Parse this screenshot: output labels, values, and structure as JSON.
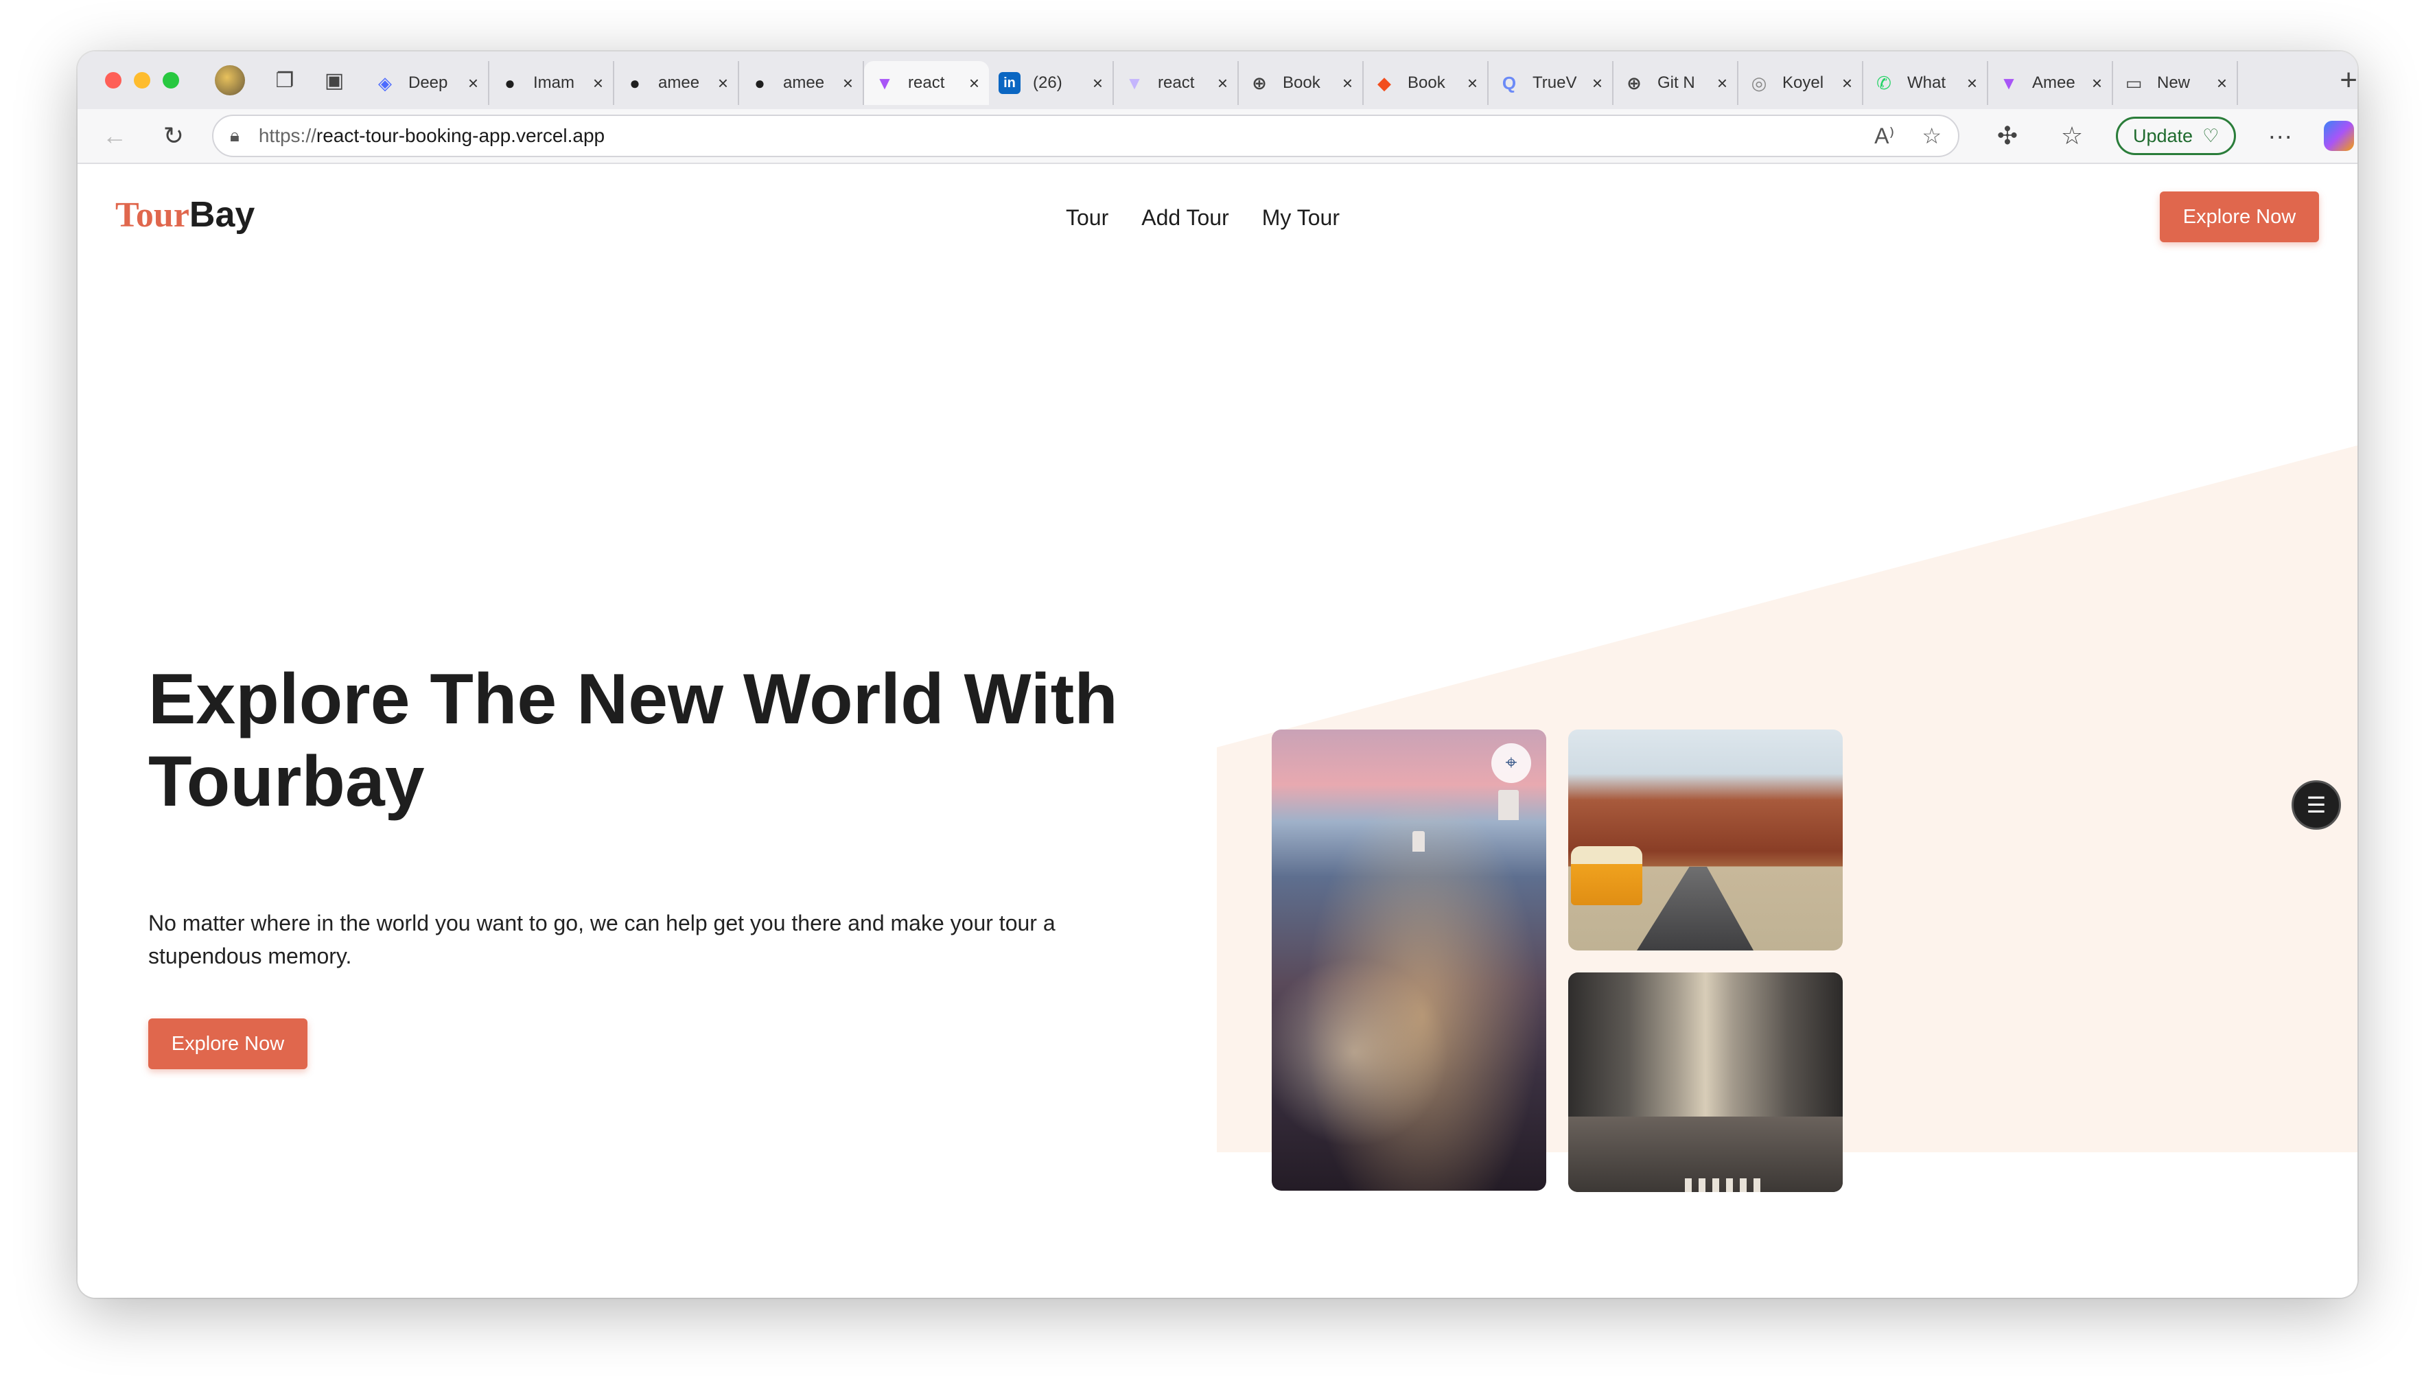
{
  "browser": {
    "tabs": [
      {
        "title": "Deep",
        "favicon": "deepseek-icon",
        "favicon_color": "#4d6bfe",
        "active": false
      },
      {
        "title": "Imam",
        "favicon": "github-icon",
        "favicon_color": "#1f1f1f",
        "active": false
      },
      {
        "title": "amee",
        "favicon": "github-icon",
        "favicon_color": "#1f1f1f",
        "active": false
      },
      {
        "title": "amee",
        "favicon": "github-icon",
        "favicon_color": "#1f1f1f",
        "active": false
      },
      {
        "title": "react",
        "favicon": "vite-icon",
        "favicon_color": "#a855f7",
        "active": true
      },
      {
        "title": "(26)",
        "favicon": "linkedin-icon",
        "favicon_color": "#0a66c2",
        "active": false
      },
      {
        "title": "react",
        "favicon": "vite-icon",
        "favicon_color": "#c4b5fd",
        "active": false
      },
      {
        "title": "Book",
        "favicon": "globe-icon",
        "favicon_color": "#444444",
        "active": false
      },
      {
        "title": "Book",
        "favicon": "figma-icon",
        "favicon_color": "#f24e1e",
        "active": false
      },
      {
        "title": "TrueV",
        "favicon": "truev-icon",
        "favicon_color": "#6b8af7",
        "active": false
      },
      {
        "title": "Git N",
        "favicon": "globe-icon",
        "favicon_color": "#444444",
        "active": false
      },
      {
        "title": "Koyel",
        "favicon": "koyeb-icon",
        "favicon_color": "#888888",
        "active": false
      },
      {
        "title": "What",
        "favicon": "whatsapp-icon",
        "favicon_color": "#25d366",
        "active": false
      },
      {
        "title": "Amee",
        "favicon": "vite-icon",
        "favicon_color": "#a855f7",
        "active": false
      },
      {
        "title": "New",
        "favicon": "new-tab-icon",
        "favicon_color": "#444444",
        "active": false
      }
    ],
    "tab_close_glyph": "×",
    "new_tab_glyph": "+",
    "address_bar": {
      "protocol": "https://",
      "host": "react-tour-booking-app.vercel.app"
    },
    "update_label": "Update",
    "more_glyph": "···"
  },
  "site": {
    "logo": {
      "part1": "Tour",
      "part2": "Bay"
    },
    "nav": [
      "Tour",
      "Add Tour",
      "My Tour"
    ],
    "header_cta": "Explore Now",
    "hero": {
      "title": "Explore The New World With Tourbay",
      "description": "No matter where in the world you want to go, we can help get you there and make your tour a stupendous memory.",
      "cta": "Explore Now"
    },
    "gallery": [
      "santorini-photo",
      "desert-road-photo",
      "city-street-photo"
    ]
  },
  "colors": {
    "accent": "#e0674d",
    "hero_bg_shape": "#fdf3ec",
    "text_dark": "#1e1e1e"
  }
}
